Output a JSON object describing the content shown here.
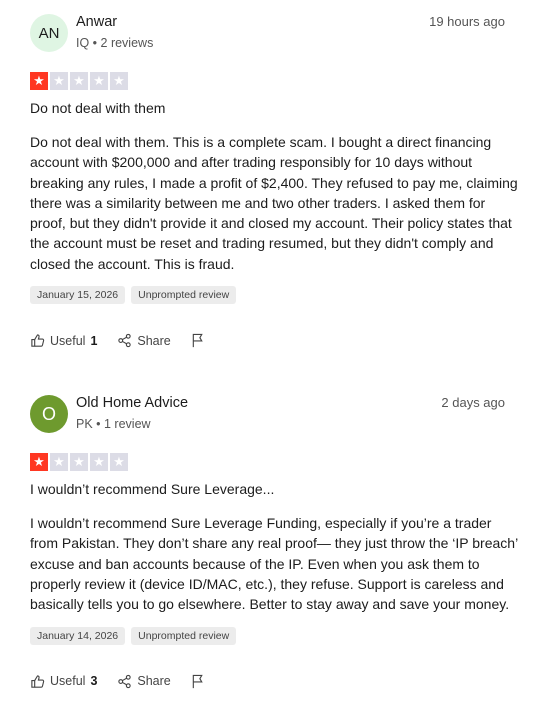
{
  "reviews": [
    {
      "avatar_initials": "AN",
      "avatar_color": "#dff5e3",
      "avatar_text_color": "#1c1c1c",
      "name": "Anwar",
      "meta": "IQ • 2 reviews",
      "time": "19 hours ago",
      "rating": 1,
      "title": "Do not deal with them",
      "body": "Do not deal with them. This is a complete scam. I bought a direct financing account with $200,000 and after trading responsibly for 10 days without breaking any rules, I made a profit of $2,400. They refused to pay me, claiming there was a similarity between me and two other traders. I asked them for proof, but they didn't provide it and closed my account. Their policy states that the account must be reset and trading resumed, but they didn't comply and closed the account. This is fraud.",
      "date_tag": "January 15, 2026",
      "type_tag": "Unprompted review",
      "useful_label": "Useful",
      "useful_count": "1",
      "share_label": "Share"
    },
    {
      "avatar_initials": "O",
      "avatar_color": "#6e9a2e",
      "avatar_text_color": "#ffffff",
      "name": "Old Home Advice",
      "meta": "PK • 1 review",
      "time": "2 days ago",
      "rating": 1,
      "title": "I wouldn’t recommend Sure Leverage...",
      "body": "I wouldn’t recommend Sure Leverage Funding, especially if you’re a trader from Pakistan. They don’t share any real proof— they just throw the ‘IP breach’ excuse and ban accounts because of the IP. Even when you ask them to properly review it (device ID/MAC, etc.), they refuse. Support is careless and basically tells you to go elsewhere. Better to stay away and save your money.",
      "date_tag": "January 14, 2026",
      "type_tag": "Unprompted review",
      "useful_label": "Useful",
      "useful_count": "3",
      "share_label": "Share"
    }
  ],
  "colors": {
    "star_filled": "#ff3722",
    "star_empty": "#dcdce6"
  },
  "icons": [
    "thumbs-up-icon",
    "share-icon",
    "flag-icon",
    "star-icon"
  ]
}
